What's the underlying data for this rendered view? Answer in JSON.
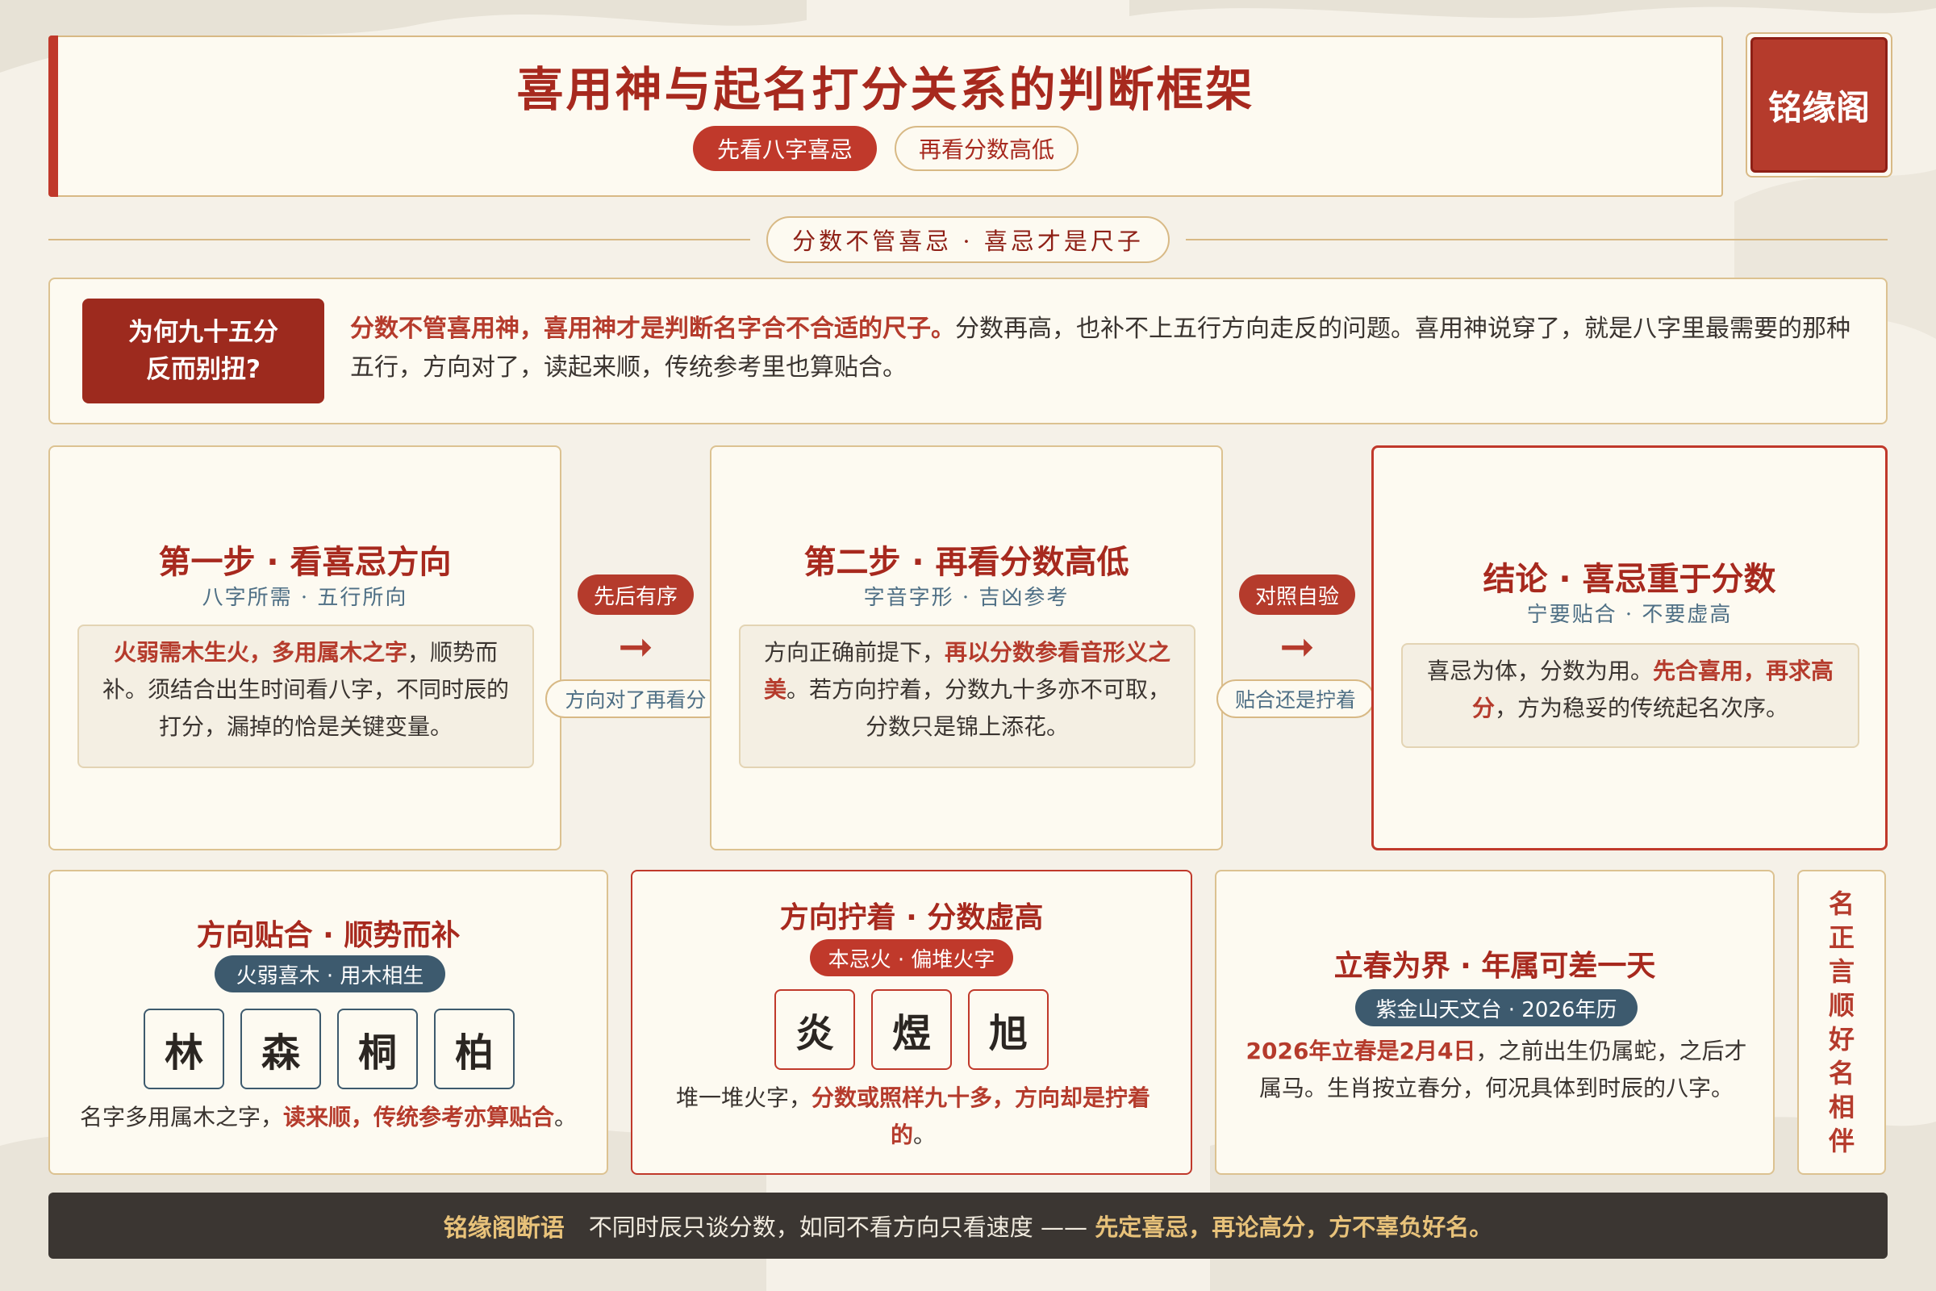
{
  "header": {
    "title": "喜用神与起名打分关系的判断框架",
    "pill_primary": "先看八字喜忌",
    "pill_secondary": "再看分数高低",
    "logo": "铭缘阁"
  },
  "divider": {
    "label": "分数不管喜忌 · 喜忌才是尺子"
  },
  "why": {
    "label_line1": "为何九十五分",
    "label_line2": "反而别扭?",
    "text_highlight": "分数不管喜用神，喜用神才是判断名字合不合适的尺子。",
    "text_rest": "分数再高，也补不上五行方向走反的问题。喜用神说穿了，就是八字里最需要的那种五行，方向对了，读起来顺，传统参考里也算贴合。"
  },
  "steps": [
    {
      "title": "第一步 · 看喜忌方向",
      "subtitle": "八字所需 · 五行所向",
      "highlight": "火弱需木生火，多用属木之字",
      "text": "，顺势而补。须结合出生时间看八字，不同时辰的打分，漏掉的恰是关键变量。"
    },
    {
      "title": "第二步 · 再看分数高低",
      "subtitle": "字音字形 · 吉凶参考",
      "text_before": "方向正确前提下，",
      "highlight": "再以分数参看音形义之美",
      "text_after": "。若方向拧着，分数九十多亦不可取，分数只是锦上添花。"
    },
    {
      "title": "结论 · 喜忌重于分数",
      "subtitle": "宁要贴合 · 不要虚高",
      "text_before": "喜忌为体，分数为用。",
      "highlight": "先合喜用，再求高分",
      "text_after": "，方为稳妥的传统起名次序。"
    }
  ],
  "connectors": [
    {
      "label": "先后有序",
      "arrow": "➞",
      "out": "方向对了再看分"
    },
    {
      "label": "对照自验",
      "arrow": "➞",
      "out": "贴合还是拧着"
    }
  ],
  "cards": [
    {
      "title": "方向贴合 · 顺势而补",
      "tag": "火弱喜木 · 用木相生",
      "chars": [
        "林",
        "森",
        "桐",
        "柏"
      ],
      "text_before": "名字多用属木之字，",
      "highlight": "读来顺，传统参考亦算贴合",
      "text_after": "。"
    },
    {
      "title": "方向拧着 · 分数虚高",
      "tag": "本忌火 · 偏堆火字",
      "chars": [
        "炎",
        "煜",
        "旭"
      ],
      "text_before": "堆一堆火字，",
      "highlight": "分数或照样九十多，方向却是拧着的",
      "text_after": "。"
    },
    {
      "title": "立春为界 · 年属可差一天",
      "tag": "紫金山天文台 · 2026年历",
      "highlight": "2026年立春是2月4日",
      "text_after": "，之前出生仍属蛇，之后才属马。生肖按立春分，何况具体到时辰的八字。"
    }
  ],
  "vertical_motto": [
    "名",
    "正",
    "言",
    "顺",
    "好",
    "名",
    "相",
    "伴"
  ],
  "footer": {
    "label": "铭缘阁断语",
    "text": "不同时辰只谈分数，如同不看方向只看速度 ——",
    "highlight": "先定喜忌，再论高分，方不辜负好名。"
  }
}
